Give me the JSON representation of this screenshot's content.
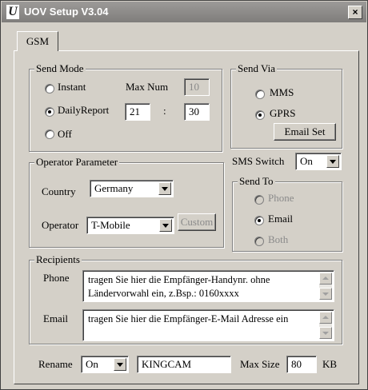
{
  "window": {
    "title": "UOV Setup V3.04",
    "icon_letter": "U",
    "close_glyph": "×"
  },
  "tabs": [
    {
      "label": "GSM",
      "active": true
    }
  ],
  "send_mode": {
    "legend": "Send Mode",
    "instant_label": "Instant",
    "daily_label": "DailyReport",
    "off_label": "Off",
    "selected": "DailyReport",
    "max_num_label": "Max Num",
    "max_num_value": "10",
    "hour_value": "21",
    "separator": ":",
    "minute_value": "30"
  },
  "send_via": {
    "legend": "Send Via",
    "mms_label": "MMS",
    "gprs_label": "GPRS",
    "selected": "GPRS",
    "email_set_label": "Email Set"
  },
  "operator": {
    "legend": "Operator Parameter",
    "country_label": "Country",
    "country_value": "Germany",
    "operator_label": "Operator",
    "operator_value": "T-Mobile",
    "custom_label": "Custom"
  },
  "sms_switch": {
    "label": "SMS Switch",
    "value": "On"
  },
  "send_to": {
    "legend": "Send To",
    "phone_label": "Phone",
    "email_label": "Email",
    "both_label": "Both",
    "selected": "Email"
  },
  "recipients": {
    "legend": "Recipients",
    "phone_label": "Phone",
    "phone_text": "tragen Sie hier die Empfänger-Handynr. ohne Ländervorwahl ein, z.Bsp.: 0160xxxx",
    "email_label": "Email",
    "email_text": "tragen Sie hier die Empfänger-E-Mail Adresse ein"
  },
  "bottom": {
    "rename_label": "Rename",
    "rename_value": "On",
    "name_value": "KINGCAM",
    "max_size_label": "Max Size",
    "max_size_value": "80",
    "unit": "KB"
  }
}
